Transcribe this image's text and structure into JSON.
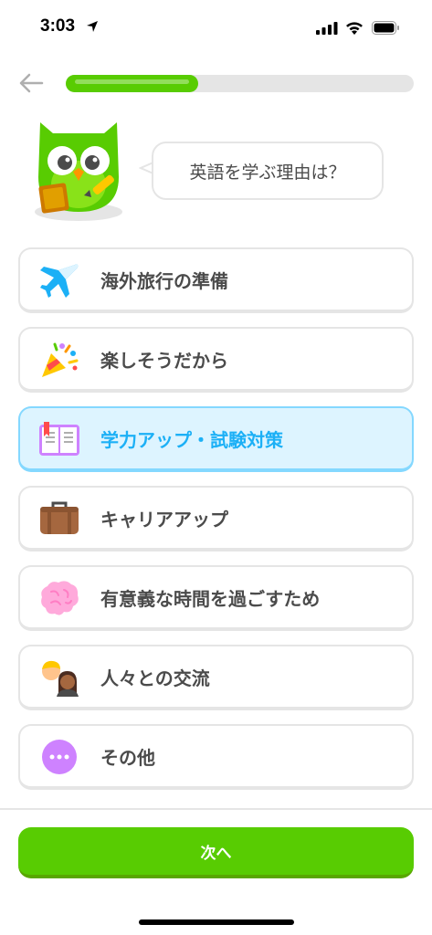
{
  "status_bar": {
    "time": "3:03"
  },
  "progress": {
    "fraction": 0.38
  },
  "prompt": {
    "question": "英語を学ぶ理由は？"
  },
  "options": [
    {
      "label": "海外旅行の準備",
      "icon": "airplane-icon",
      "selected": false
    },
    {
      "label": "楽しそうだから",
      "icon": "party-popper-icon",
      "selected": false
    },
    {
      "label": "学力アップ・試験対策",
      "icon": "book-icon",
      "selected": true
    },
    {
      "label": "キャリアアップ",
      "icon": "briefcase-icon",
      "selected": false
    },
    {
      "label": "有意義な時間を過ごすため",
      "icon": "brain-icon",
      "selected": false
    },
    {
      "label": "人々との交流",
      "icon": "people-icon",
      "selected": false
    },
    {
      "label": "その他",
      "icon": "more-icon",
      "selected": false
    }
  ],
  "footer": {
    "next_label": "次へ"
  },
  "colors": {
    "accent_green": "#58cc02",
    "selected_bg": "#ddf4ff",
    "selected_border": "#84d8ff",
    "selected_text": "#1cb0f6"
  }
}
